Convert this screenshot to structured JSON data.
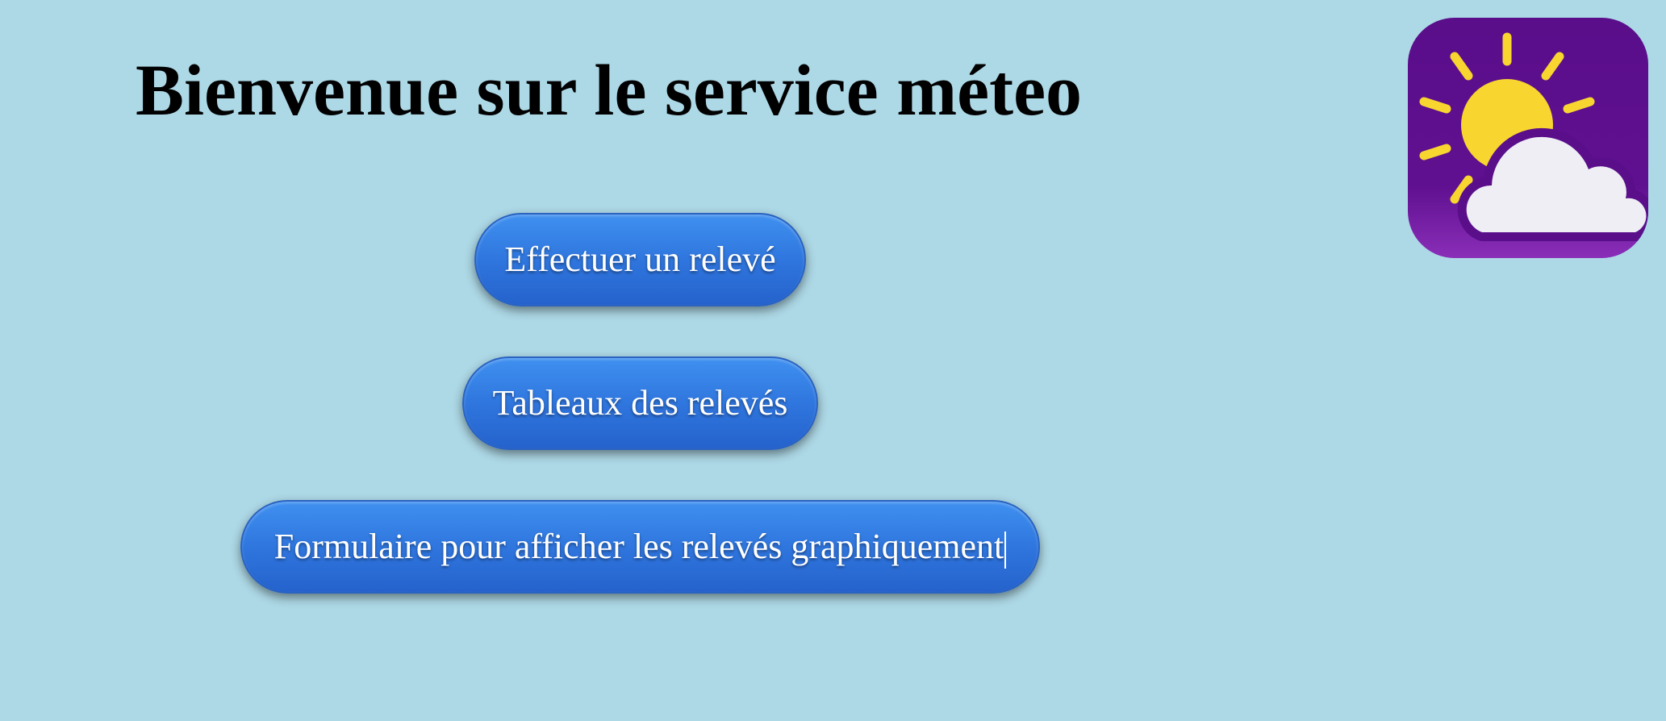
{
  "page": {
    "title": "Bienvenue sur le service méteo"
  },
  "buttons": {
    "releve": "Effectuer un relevé",
    "tableaux": "Tableaux des relevés",
    "formulaire": "Formulaire pour afficher les relevés graphiquement"
  },
  "logo": {
    "icon": "sun-cloud-weather-icon",
    "background_color": "#5A0E8A",
    "sun_color": "#F9D52F",
    "cloud_color": "#EEEEF4"
  },
  "colors": {
    "page_background": "#ADD8E6",
    "button_blue": "#2F76DE",
    "button_text": "#FFFFFF"
  }
}
